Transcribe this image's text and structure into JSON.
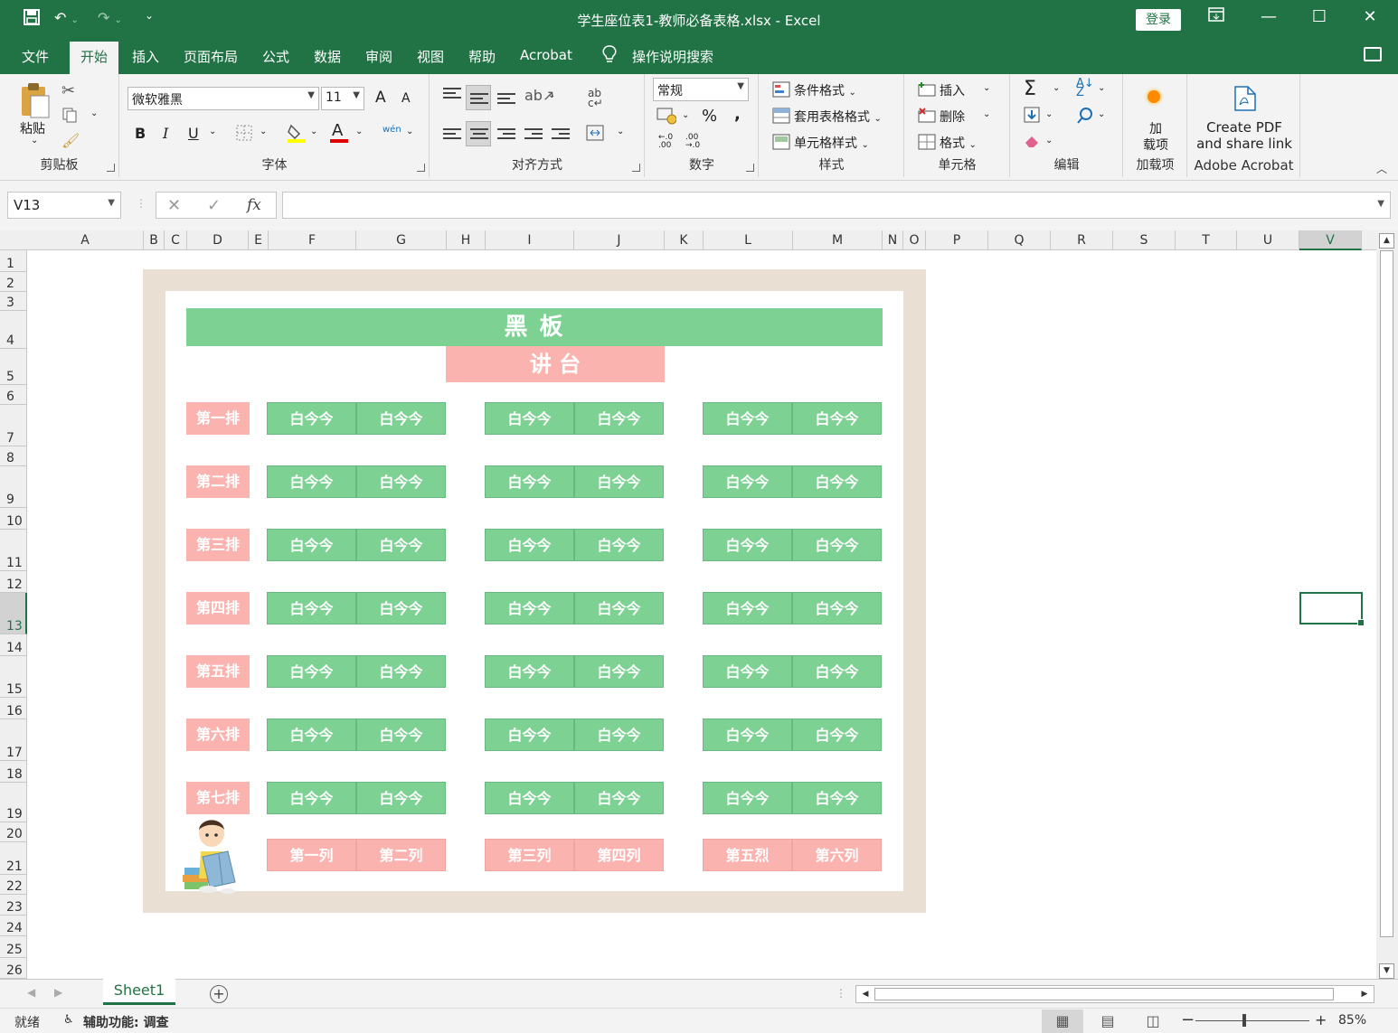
{
  "titlebar": {
    "title": "学生座位表1-教师必备表格.xlsx  -  Excel",
    "login": "登录",
    "save_icon": "save-icon",
    "undo_icon": "undo-icon",
    "redo_icon": "redo-icon"
  },
  "menu": {
    "tabs": [
      "文件",
      "开始",
      "插入",
      "页面布局",
      "公式",
      "数据",
      "审阅",
      "视图",
      "帮助",
      "Acrobat"
    ],
    "active_tab": "开始",
    "search": "操作说明搜索"
  },
  "ribbon": {
    "clipboard": {
      "label": "剪贴板",
      "paste": "粘贴"
    },
    "font": {
      "label": "字体",
      "font_name": "微软雅黑",
      "font_size": "11",
      "bold": "B",
      "italic": "I",
      "underline": "U",
      "grow": "A",
      "shrink": "A",
      "color_a": "A",
      "wen": "wén"
    },
    "alignment": {
      "label": "对齐方式"
    },
    "number": {
      "label": "数字",
      "format": "常规",
      "percent": "%",
      "comma": ","
    },
    "styles": {
      "label": "样式",
      "conditional": "条件格式",
      "table_format": "套用表格格式",
      "cell_styles": "单元格样式"
    },
    "cells": {
      "label": "单元格",
      "insert": "插入",
      "delete": "删除",
      "format": "格式"
    },
    "editing": {
      "label": "编辑"
    },
    "addins": {
      "label": "加载项",
      "button_line1": "加",
      "button_line2": "载项"
    },
    "acrobat": {
      "label": "Adobe Acrobat",
      "line1": "Create PDF",
      "line2": "and share link"
    }
  },
  "formula_bar": {
    "name_box": "V13",
    "fx": "fx",
    "value": ""
  },
  "columns": [
    "A",
    "B",
    "C",
    "D",
    "E",
    "F",
    "G",
    "H",
    "I",
    "J",
    "K",
    "L",
    "M",
    "N",
    "O",
    "P",
    "Q",
    "R",
    "S",
    "T",
    "U",
    "V"
  ],
  "selected_column": "V",
  "rows": [
    "1",
    "2",
    "3",
    "4",
    "5",
    "6",
    "7",
    "8",
    "9",
    "10",
    "11",
    "12",
    "13",
    "14",
    "15",
    "16",
    "17",
    "18",
    "19",
    "20",
    "21",
    "22",
    "23",
    "24",
    "25",
    "26"
  ],
  "selected_row": "13",
  "seating": {
    "blackboard": "黑        板",
    "podium": "讲    台",
    "row_labels": [
      "第一排",
      "第二排",
      "第三排",
      "第四排",
      "第五排",
      "第六排",
      "第七排"
    ],
    "seat_name": "白今今",
    "column_labels": [
      "第一列",
      "第二列",
      "第三列",
      "第四列",
      "第五烈",
      "第六列"
    ]
  },
  "sheets": {
    "tabs": [
      "Sheet1"
    ],
    "active": "Sheet1"
  },
  "status": {
    "ready": "就绪",
    "accessibility": "辅助功能: 调查",
    "zoom": "85%",
    "minus": "−",
    "plus": "+"
  },
  "colors": {
    "excel_green": "#217346",
    "seat_green": "#7dd193",
    "label_pink": "#fbb3b0",
    "frame_beige": "#e9e0d3"
  }
}
